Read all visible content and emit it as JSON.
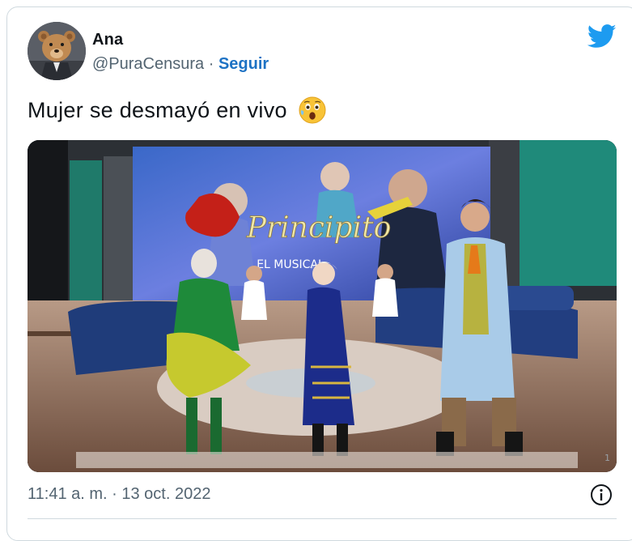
{
  "author": {
    "name": "Ana",
    "handle": "@PuraCensura",
    "separator": " · ",
    "follow_label": "Seguir"
  },
  "tweet": {
    "text": "Mujer se desmayó en vivo",
    "emoji_icon": "astonished-face-emoji",
    "timestamp": "11:41 a. m. · 13 oct. 2022"
  },
  "media": {
    "screen_logo_text": "Principito",
    "screen_subtitle": "EL MUSICAL",
    "corner_mark": "1"
  },
  "colors": {
    "link_blue": "#1d72c4",
    "twitter_blue": "#1d9bf0",
    "muted_text": "#536471",
    "border": "#cfd9de"
  },
  "icons": [
    "twitter-bird-icon",
    "info-icon"
  ]
}
